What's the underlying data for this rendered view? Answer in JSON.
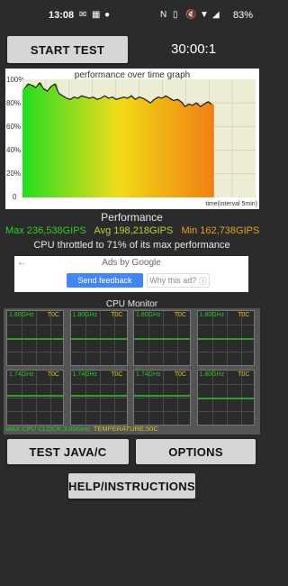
{
  "status_bar": {
    "time": "13:08",
    "notification_icons": [
      "message-icon",
      "calendar-icon",
      "android-icon"
    ],
    "system_icons": [
      "nfc-icon",
      "vibrate-icon",
      "mute-icon",
      "wifi-icon",
      "signal-icon"
    ],
    "battery": "83%"
  },
  "controls": {
    "start_test": "START TEST",
    "timer": "30:00:1",
    "test_java": "TEST JAVA/C",
    "options": "OPTIONS",
    "help": "HELP/INSTRUCTIONS"
  },
  "graph": {
    "title": "performance over time graph",
    "y_ticks": [
      "100%",
      "80%",
      "60%",
      "40%",
      "20%",
      "0"
    ],
    "interval_label": "time(interval 5min)",
    "chart_data": {
      "type": "line",
      "xlabel": "time(interval 5min)",
      "ylim": [
        0,
        100
      ],
      "y": [
        92,
        96,
        95,
        93,
        97,
        92,
        90,
        94,
        96,
        88,
        86,
        84,
        83,
        85,
        84,
        86,
        85,
        84,
        85,
        83,
        84,
        86,
        84,
        85,
        83,
        84,
        85,
        84,
        86,
        83,
        85,
        84,
        82,
        80,
        83,
        85,
        84,
        86,
        84,
        82,
        83,
        81,
        77,
        79,
        78,
        80,
        77,
        79,
        81,
        79
      ]
    }
  },
  "performance": {
    "heading": "Performance",
    "max": "Max 236,538GIPS",
    "avg": "Avg 198,218GIPS",
    "min": "Min 162,738GIPS",
    "throttle": "CPU throttled to 71% of its max performance",
    "colors": {
      "max": "#2ecc2e",
      "avg": "#b6d23a",
      "min": "#e6a020"
    }
  },
  "ad": {
    "back": "←",
    "label": "Ads by Google",
    "send_feedback": "Send feedback",
    "why": "Why this ad?",
    "info_icon": "info-icon"
  },
  "cpu": {
    "title": "CPU Monitor",
    "cores": [
      {
        "freq": "1.80GHz",
        "temp": "T0C",
        "level": 0.5
      },
      {
        "freq": "1.80GHz",
        "temp": "T0C",
        "level": 0.5
      },
      {
        "freq": "1.80GHz",
        "temp": "T0C",
        "level": 0.5
      },
      {
        "freq": "1.80GHz",
        "temp": "T0C",
        "level": 0.5
      },
      {
        "freq": "1.74GHz",
        "temp": "T0C",
        "level": 0.55
      },
      {
        "freq": "1.74GHz",
        "temp": "T0C",
        "level": 0.55
      },
      {
        "freq": "1.74GHz",
        "temp": "T0C",
        "level": 0.55
      },
      {
        "freq": "1.80GHz",
        "temp": "T0C",
        "level": 0.5
      }
    ],
    "footer_clock": "MAX CPU CLOCK:3.00GHz,",
    "footer_temp": "TEMPERATURE:50C"
  }
}
